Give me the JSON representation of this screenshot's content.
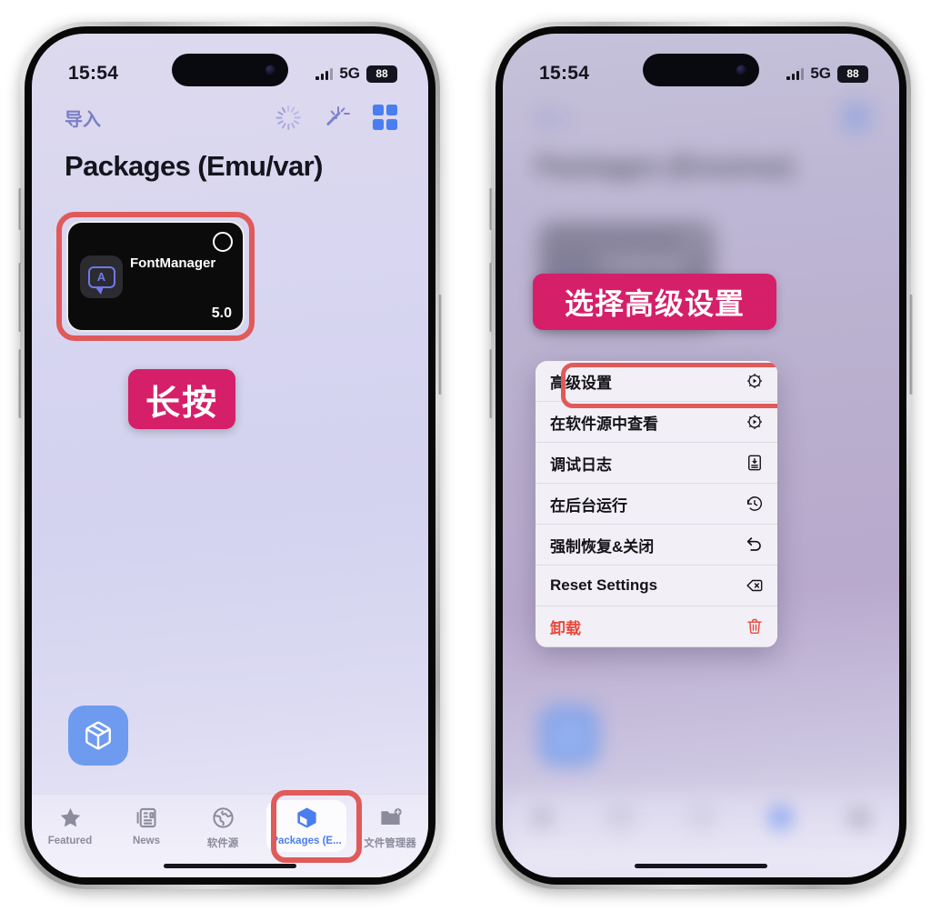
{
  "status_bar": {
    "time": "15:54",
    "network": "5G",
    "battery": "88"
  },
  "left_phone": {
    "nav": {
      "left_button": "导入",
      "icons": [
        "loading-spinner-icon",
        "magic-wand-icon",
        "grid-view-icon"
      ]
    },
    "page_title": "Packages (Emu/var)",
    "package_card": {
      "name": "FontManager",
      "version": "5.0",
      "icon_letter": "A",
      "selected": false
    },
    "callout": "长按",
    "fab_icon": "package-box-icon",
    "tabs": [
      {
        "label": "Featured",
        "icon": "star-icon",
        "active": false
      },
      {
        "label": "News",
        "icon": "newspaper-icon",
        "active": false
      },
      {
        "label": "软件源",
        "icon": "globe-icon",
        "active": false
      },
      {
        "label": "Packages (E...",
        "icon": "package-box-icon",
        "active": true
      },
      {
        "label": "文件管理器",
        "icon": "folder-add-icon",
        "active": false
      }
    ]
  },
  "right_phone": {
    "callout": "选择高级设置",
    "context_menu": [
      {
        "label": "高级设置",
        "icon": "gear-play-icon",
        "danger": false,
        "highlighted": true
      },
      {
        "label": "在软件源中查看",
        "icon": "gear-play-icon",
        "danger": false,
        "highlighted": false
      },
      {
        "label": "调试日志",
        "icon": "document-log-icon",
        "danger": false,
        "highlighted": false
      },
      {
        "label": "在后台运行",
        "icon": "clock-arrow-icon",
        "danger": false,
        "highlighted": false
      },
      {
        "label": "强制恢复&关闭",
        "icon": "undo-arrow-icon",
        "danger": false,
        "highlighted": false
      },
      {
        "label": "Reset Settings",
        "icon": "delete-left-icon",
        "danger": false,
        "highlighted": false
      },
      {
        "label": "卸载",
        "icon": "trash-icon",
        "danger": true,
        "highlighted": false
      }
    ]
  },
  "colors": {
    "accent_blue": "#4a7ef0",
    "callout_pink": "#d51f69",
    "highlight_red": "#e05a5a",
    "danger_red": "#e8483c",
    "screen_bg": "#d5d5f0"
  }
}
